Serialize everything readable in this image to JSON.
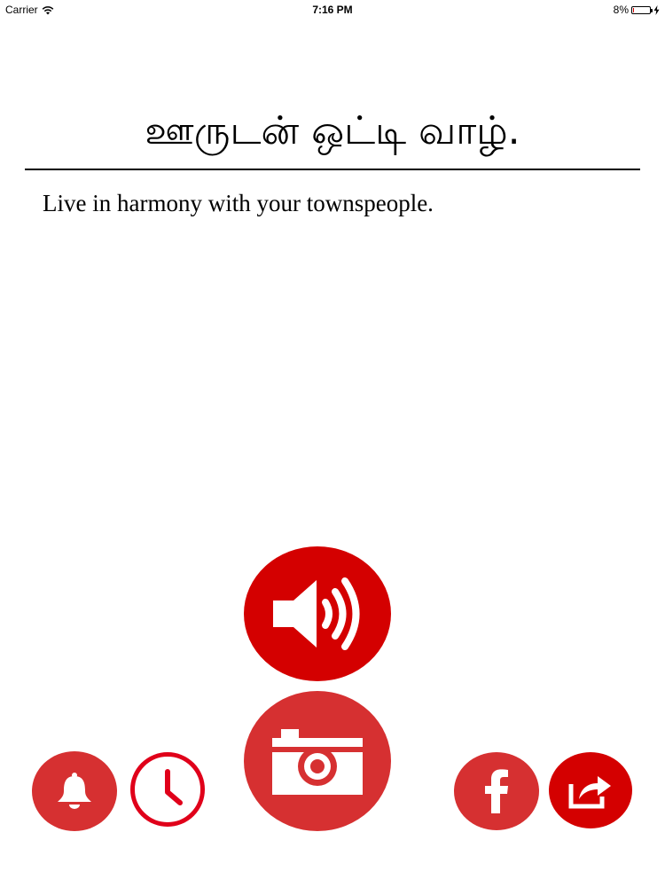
{
  "status_bar": {
    "carrier": "Carrier",
    "time": "7:16 PM",
    "battery_percent_label": "8%",
    "battery_level": 0.08
  },
  "content": {
    "headline_tamil": "ஊருடன் ஒட்டி வாழ்.",
    "translation": "Live in harmony with your townspeople."
  },
  "controls": {
    "speaker_icon": "speaker-icon",
    "camera_icon": "camera-icon",
    "bell_icon": "bell-icon",
    "clock_icon": "clock-icon",
    "facebook_icon": "facebook-icon",
    "share_icon": "share-icon"
  },
  "colors": {
    "primary_red": "#d40000",
    "secondary_red": "#d63031",
    "clock_ring": "#e0001a",
    "text": "#000000",
    "background": "#ffffff"
  }
}
